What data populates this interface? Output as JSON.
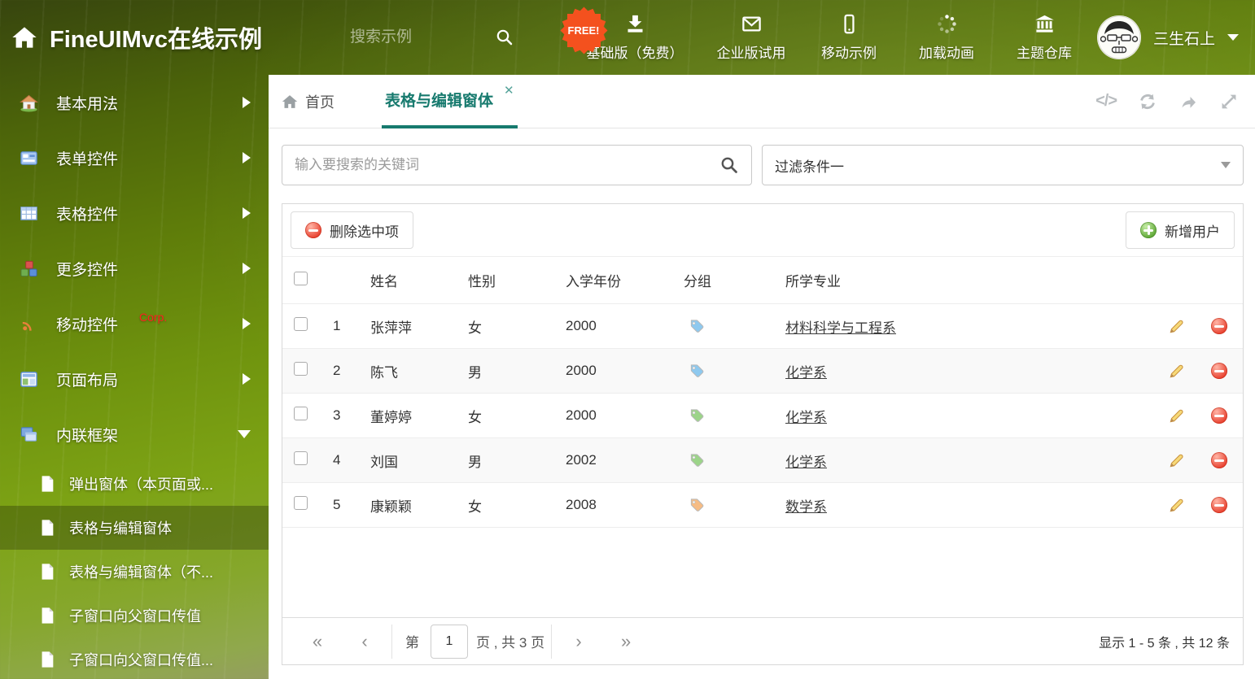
{
  "colors": {
    "accent": "#177a6e",
    "free_badge": "#f4511e",
    "delete_red": "#e8402e",
    "add_green": "#58a32f"
  },
  "header": {
    "title": "FineUIMvc在线示例",
    "search_placeholder": "搜索示例",
    "free_badge": "FREE!",
    "nav_items": [
      {
        "label": "基础版（免费）",
        "icon": "download-icon"
      },
      {
        "label": "企业版试用",
        "icon": "envelope-icon"
      },
      {
        "label": "移动示例",
        "icon": "mobile-icon"
      },
      {
        "label": "加载动画",
        "icon": "spinner-icon"
      },
      {
        "label": "主题仓库",
        "icon": "bank-icon"
      }
    ],
    "username": "三生石上"
  },
  "sidebar": {
    "items": [
      {
        "label": "基本用法",
        "icon": "home-icon"
      },
      {
        "label": "表单控件",
        "icon": "form-icon"
      },
      {
        "label": "表格控件",
        "icon": "grid-icon"
      },
      {
        "label": "更多控件",
        "icon": "cubes-icon"
      },
      {
        "label": "移动控件",
        "icon": "antenna-icon",
        "badge": "Corp."
      },
      {
        "label": "页面布局",
        "icon": "layout-icon"
      },
      {
        "label": "内联框架",
        "icon": "frames-icon",
        "expanded": true
      }
    ],
    "subitems": [
      {
        "label": "弹出窗体（本页面或..."
      },
      {
        "label": "表格与编辑窗体",
        "selected": true
      },
      {
        "label": "表格与编辑窗体（不..."
      },
      {
        "label": "子窗口向父窗口传值"
      },
      {
        "label": "子窗口向父窗口传值..."
      }
    ]
  },
  "tabs": {
    "home": "首页",
    "active": "表格与编辑窗体",
    "close_icon": "✕"
  },
  "tab_tools": {
    "code_label": "</>"
  },
  "filters": {
    "search_placeholder": "输入要搜索的关键词",
    "filter_dropdown_value": "过滤条件一"
  },
  "grid": {
    "delete_button": "删除选中项",
    "add_button": "新增用户",
    "columns": [
      "姓名",
      "性别",
      "入学年份",
      "分组",
      "所学专业"
    ],
    "rows": [
      {
        "index": 1,
        "name": "张萍萍",
        "gender": "女",
        "year": "2000",
        "tag_color": "#8ec9ef",
        "major": "材料科学与工程系"
      },
      {
        "index": 2,
        "name": "陈飞",
        "gender": "男",
        "year": "2000",
        "tag_color": "#8ec9ef",
        "major": "化学系"
      },
      {
        "index": 3,
        "name": "董婷婷",
        "gender": "女",
        "year": "2000",
        "tag_color": "#9cd489",
        "major": "化学系"
      },
      {
        "index": 4,
        "name": "刘国",
        "gender": "男",
        "year": "2002",
        "tag_color": "#9cd489",
        "major": "化学系"
      },
      {
        "index": 5,
        "name": "康颖颖",
        "gender": "女",
        "year": "2008",
        "tag_color": "#f6bc84",
        "major": "数学系"
      }
    ],
    "pagination": {
      "first_icon": "«",
      "prev_icon": "‹",
      "page_prefix": "第",
      "current_page": "1",
      "page_suffix": "页 , 共 3 页",
      "next_icon": "›",
      "last_icon": "»",
      "summary": "显示 1 - 5 条 , 共 12 条"
    }
  }
}
